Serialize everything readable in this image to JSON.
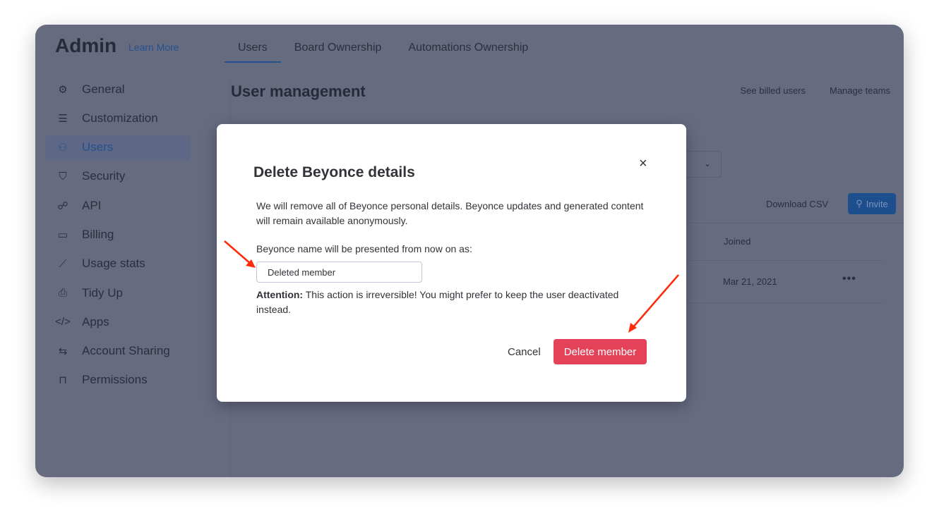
{
  "header": {
    "title": "Admin",
    "learn_more": "Learn More"
  },
  "tabs": [
    {
      "label": "Users"
    },
    {
      "label": "Board Ownership"
    },
    {
      "label": "Automations Ownership"
    }
  ],
  "sidebar": {
    "items": [
      {
        "label": "General",
        "icon": "gear-icon"
      },
      {
        "label": "Customization",
        "icon": "sliders-icon"
      },
      {
        "label": "Users",
        "icon": "users-icon"
      },
      {
        "label": "Security",
        "icon": "shield-icon"
      },
      {
        "label": "API",
        "icon": "api-icon"
      },
      {
        "label": "Billing",
        "icon": "card-icon"
      },
      {
        "label": "Usage stats",
        "icon": "chart-icon"
      },
      {
        "label": "Tidy Up",
        "icon": "shredder-icon"
      },
      {
        "label": "Apps",
        "icon": "code-icon"
      },
      {
        "label": "Account Sharing",
        "icon": "swap-icon"
      },
      {
        "label": "Permissions",
        "icon": "lock-icon"
      }
    ]
  },
  "main": {
    "title": "User management",
    "see_billed": "See billed users",
    "manage_teams": "Manage teams",
    "download_csv": "Download CSV",
    "invite": "Invite",
    "col_joined": "Joined",
    "row_date": "Mar 21, 2021",
    "more": "•••"
  },
  "modal": {
    "title": "Delete Beyonce details",
    "close": "×",
    "description": "We will remove all of Beyonce personal details. Beyonce updates and generated content will remain available anonymously.",
    "label": "Beyonce name will be presented from now on as:",
    "input_value": "Deleted member",
    "attention_bold": "Attention:",
    "attention_text": " This action is irreversible! You might prefer to keep the user deactivated instead.",
    "cancel": "Cancel",
    "delete": "Delete member"
  },
  "colors": {
    "accent": "#0073ea",
    "danger": "#e44258",
    "annotation": "#ff2a0a"
  }
}
